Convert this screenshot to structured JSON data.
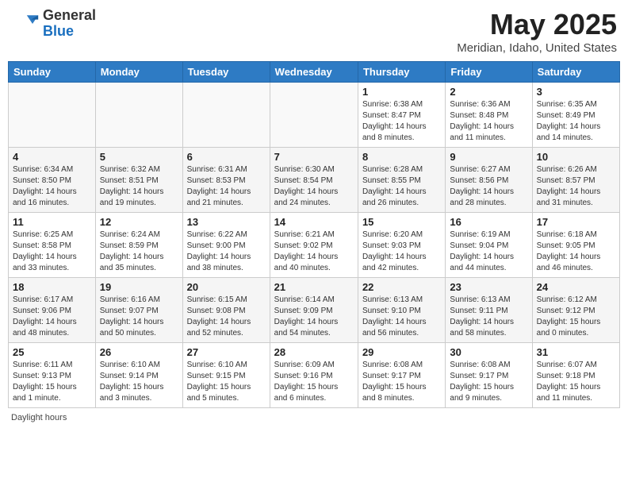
{
  "header": {
    "logo_general": "General",
    "logo_blue": "Blue",
    "title": "May 2025",
    "location": "Meridian, Idaho, United States"
  },
  "days_of_week": [
    "Sunday",
    "Monday",
    "Tuesday",
    "Wednesday",
    "Thursday",
    "Friday",
    "Saturday"
  ],
  "weeks": [
    [
      {
        "num": "",
        "info": ""
      },
      {
        "num": "",
        "info": ""
      },
      {
        "num": "",
        "info": ""
      },
      {
        "num": "",
        "info": ""
      },
      {
        "num": "1",
        "info": "Sunrise: 6:38 AM\nSunset: 8:47 PM\nDaylight: 14 hours\nand 8 minutes."
      },
      {
        "num": "2",
        "info": "Sunrise: 6:36 AM\nSunset: 8:48 PM\nDaylight: 14 hours\nand 11 minutes."
      },
      {
        "num": "3",
        "info": "Sunrise: 6:35 AM\nSunset: 8:49 PM\nDaylight: 14 hours\nand 14 minutes."
      }
    ],
    [
      {
        "num": "4",
        "info": "Sunrise: 6:34 AM\nSunset: 8:50 PM\nDaylight: 14 hours\nand 16 minutes."
      },
      {
        "num": "5",
        "info": "Sunrise: 6:32 AM\nSunset: 8:51 PM\nDaylight: 14 hours\nand 19 minutes."
      },
      {
        "num": "6",
        "info": "Sunrise: 6:31 AM\nSunset: 8:53 PM\nDaylight: 14 hours\nand 21 minutes."
      },
      {
        "num": "7",
        "info": "Sunrise: 6:30 AM\nSunset: 8:54 PM\nDaylight: 14 hours\nand 24 minutes."
      },
      {
        "num": "8",
        "info": "Sunrise: 6:28 AM\nSunset: 8:55 PM\nDaylight: 14 hours\nand 26 minutes."
      },
      {
        "num": "9",
        "info": "Sunrise: 6:27 AM\nSunset: 8:56 PM\nDaylight: 14 hours\nand 28 minutes."
      },
      {
        "num": "10",
        "info": "Sunrise: 6:26 AM\nSunset: 8:57 PM\nDaylight: 14 hours\nand 31 minutes."
      }
    ],
    [
      {
        "num": "11",
        "info": "Sunrise: 6:25 AM\nSunset: 8:58 PM\nDaylight: 14 hours\nand 33 minutes."
      },
      {
        "num": "12",
        "info": "Sunrise: 6:24 AM\nSunset: 8:59 PM\nDaylight: 14 hours\nand 35 minutes."
      },
      {
        "num": "13",
        "info": "Sunrise: 6:22 AM\nSunset: 9:00 PM\nDaylight: 14 hours\nand 38 minutes."
      },
      {
        "num": "14",
        "info": "Sunrise: 6:21 AM\nSunset: 9:02 PM\nDaylight: 14 hours\nand 40 minutes."
      },
      {
        "num": "15",
        "info": "Sunrise: 6:20 AM\nSunset: 9:03 PM\nDaylight: 14 hours\nand 42 minutes."
      },
      {
        "num": "16",
        "info": "Sunrise: 6:19 AM\nSunset: 9:04 PM\nDaylight: 14 hours\nand 44 minutes."
      },
      {
        "num": "17",
        "info": "Sunrise: 6:18 AM\nSunset: 9:05 PM\nDaylight: 14 hours\nand 46 minutes."
      }
    ],
    [
      {
        "num": "18",
        "info": "Sunrise: 6:17 AM\nSunset: 9:06 PM\nDaylight: 14 hours\nand 48 minutes."
      },
      {
        "num": "19",
        "info": "Sunrise: 6:16 AM\nSunset: 9:07 PM\nDaylight: 14 hours\nand 50 minutes."
      },
      {
        "num": "20",
        "info": "Sunrise: 6:15 AM\nSunset: 9:08 PM\nDaylight: 14 hours\nand 52 minutes."
      },
      {
        "num": "21",
        "info": "Sunrise: 6:14 AM\nSunset: 9:09 PM\nDaylight: 14 hours\nand 54 minutes."
      },
      {
        "num": "22",
        "info": "Sunrise: 6:13 AM\nSunset: 9:10 PM\nDaylight: 14 hours\nand 56 minutes."
      },
      {
        "num": "23",
        "info": "Sunrise: 6:13 AM\nSunset: 9:11 PM\nDaylight: 14 hours\nand 58 minutes."
      },
      {
        "num": "24",
        "info": "Sunrise: 6:12 AM\nSunset: 9:12 PM\nDaylight: 15 hours\nand 0 minutes."
      }
    ],
    [
      {
        "num": "25",
        "info": "Sunrise: 6:11 AM\nSunset: 9:13 PM\nDaylight: 15 hours\nand 1 minute."
      },
      {
        "num": "26",
        "info": "Sunrise: 6:10 AM\nSunset: 9:14 PM\nDaylight: 15 hours\nand 3 minutes."
      },
      {
        "num": "27",
        "info": "Sunrise: 6:10 AM\nSunset: 9:15 PM\nDaylight: 15 hours\nand 5 minutes."
      },
      {
        "num": "28",
        "info": "Sunrise: 6:09 AM\nSunset: 9:16 PM\nDaylight: 15 hours\nand 6 minutes."
      },
      {
        "num": "29",
        "info": "Sunrise: 6:08 AM\nSunset: 9:17 PM\nDaylight: 15 hours\nand 8 minutes."
      },
      {
        "num": "30",
        "info": "Sunrise: 6:08 AM\nSunset: 9:17 PM\nDaylight: 15 hours\nand 9 minutes."
      },
      {
        "num": "31",
        "info": "Sunrise: 6:07 AM\nSunset: 9:18 PM\nDaylight: 15 hours\nand 11 minutes."
      }
    ]
  ],
  "footer": {
    "label": "Daylight hours"
  }
}
